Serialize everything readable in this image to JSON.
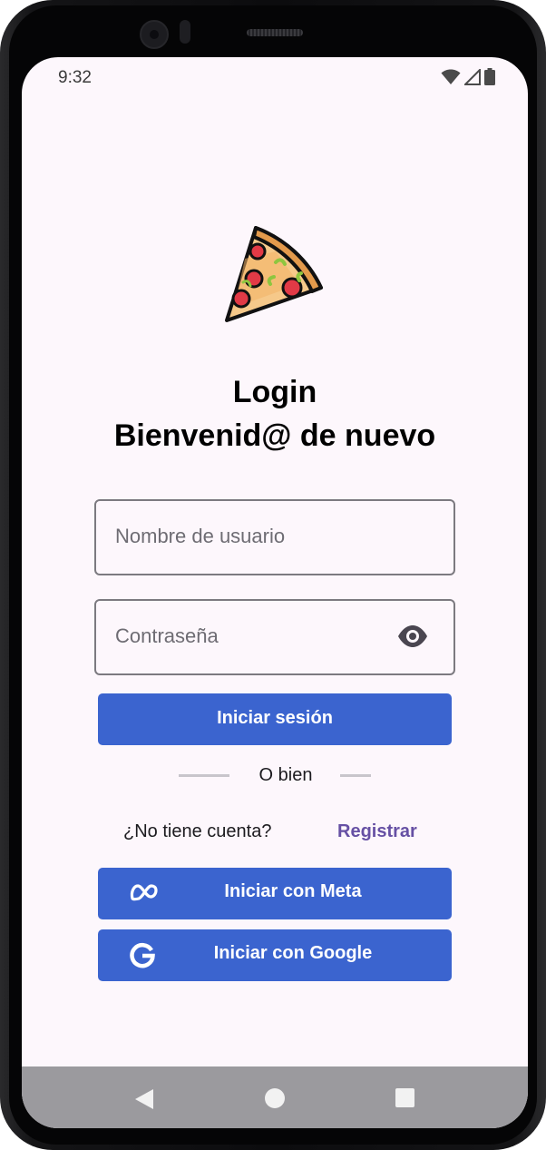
{
  "status_bar": {
    "time": "9:32",
    "icons": [
      "wifi-icon",
      "cell-signal-icon",
      "battery-icon"
    ]
  },
  "logo": {
    "icon": "pizza-slice-icon"
  },
  "header": {
    "title": "Login",
    "subtitle": "Bienvenid@ de nuevo"
  },
  "form": {
    "username_placeholder": "Nombre de usuario",
    "password_placeholder": "Contraseña",
    "password_toggle_icon": "eye-icon",
    "login_button": "Iniciar sesión"
  },
  "divider": {
    "text": "O bien"
  },
  "register": {
    "prompt": "¿No tiene cuenta?",
    "link": "Registrar"
  },
  "social": {
    "meta_button": "Iniciar con Meta",
    "meta_icon": "meta-logo-icon",
    "google_button": "Iniciar con Google",
    "google_icon": "google-logo-icon"
  },
  "nav": {
    "icons": [
      "back-icon",
      "home-icon",
      "recents-icon"
    ]
  },
  "colors": {
    "screen_background": "#fdf7fc",
    "primary_button": "#3b64cf",
    "link": "#6650a4",
    "nav_bar": "#9b9a9e"
  }
}
